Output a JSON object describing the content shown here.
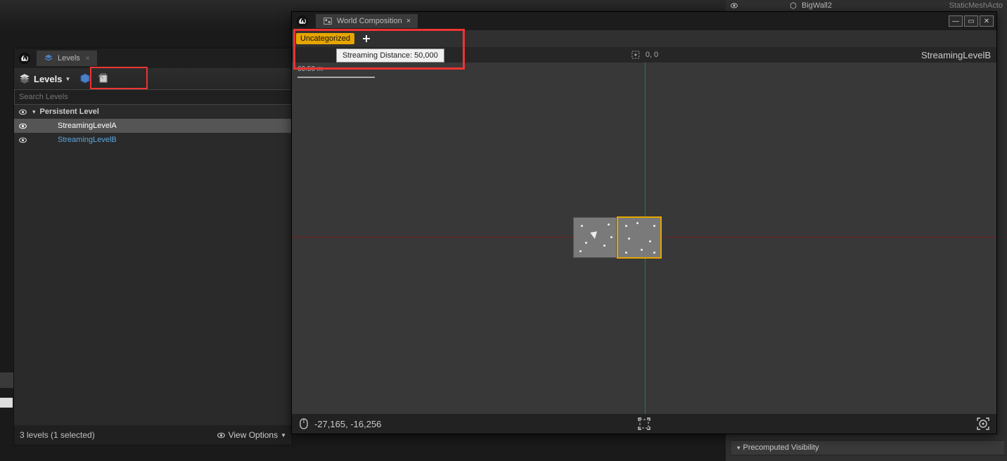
{
  "outliner": {
    "item_name": "BigWall2",
    "item_type": "StaticMeshActo"
  },
  "details": {
    "section": "Precomputed Visibility"
  },
  "levels_panel": {
    "tab_label": "Levels",
    "dropdown_label": "Levels",
    "search_placeholder": "Search Levels",
    "rows": {
      "persistent": "Persistent Level",
      "a": "StreamingLevelA",
      "b": "StreamingLevelB"
    },
    "status": "3 levels (1 selected)",
    "view_options": "View Options"
  },
  "world_comp": {
    "tab_label": "World Composition",
    "layer_name": "Uncategorized",
    "tooltip": "Streaming Distance: 50,000",
    "ruler_origin": "0, 0",
    "current_level": "StreamingLevelB",
    "scale_label": "60.50 m",
    "mouse_coords": "-27,165, -16,256"
  }
}
